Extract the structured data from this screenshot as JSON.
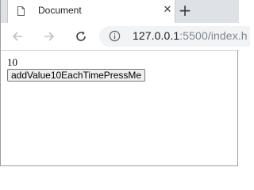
{
  "browser": {
    "tab": {
      "title": "Document",
      "close_glyph": "✕"
    },
    "new_tab_glyph": "+",
    "address": {
      "host": "127.0.0.1",
      "rest": ":5500/index.h"
    },
    "icons": {
      "tab": "document-icon",
      "back": "back-arrow-icon",
      "forward": "forward-arrow-icon",
      "reload": "reload-icon",
      "info": "info-icon"
    }
  },
  "page": {
    "value": "10",
    "button_label": "addValue10EachTimePressMe"
  }
}
